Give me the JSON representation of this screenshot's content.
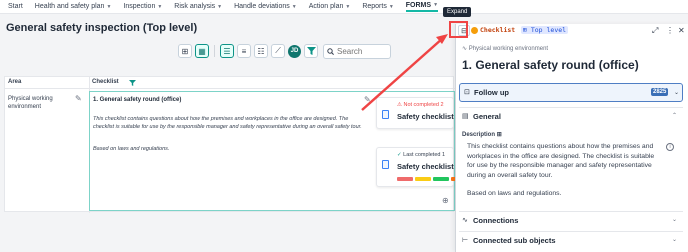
{
  "nav": {
    "items": [
      {
        "label": "Start",
        "dropdown": false
      },
      {
        "label": "Health and safety plan",
        "dropdown": true
      },
      {
        "label": "Inspection",
        "dropdown": true
      },
      {
        "label": "Risk analysis",
        "dropdown": true
      },
      {
        "label": "Handle deviations",
        "dropdown": true
      },
      {
        "label": "Action plan",
        "dropdown": true
      },
      {
        "label": "Reports",
        "dropdown": true
      },
      {
        "label": "FORMS",
        "dropdown": true
      }
    ],
    "active": "FORMS"
  },
  "page": {
    "title": "General safety inspection (Top level)"
  },
  "toolbar": {
    "avatar_initials": "JD",
    "search_placeholder": "Search"
  },
  "grid": {
    "columns": [
      "Area",
      "Checklist"
    ],
    "row": {
      "area": "Physical working environment",
      "checklist_title": "1. General safety round (office)",
      "checklist_desc": "This checklist contains questions about how the premises and workplaces in the office are designed. The checklist is suitable for use by the responsible manager and safety representative during an overall safety tour.",
      "checklist_based": "Based on laws and regulations."
    },
    "cards": [
      {
        "status": "Not completed",
        "status_suffix": "2",
        "title": "Safety checklist",
        "status_color": "#ef4444"
      },
      {
        "status": "Last completed",
        "status_suffix": "1",
        "title": "Safety checklist",
        "status_color": "#0d9488"
      }
    ],
    "bar_colors": [
      "#ef6b6b",
      "#facc15",
      "#22c55e",
      "#f97316"
    ]
  },
  "tooltip": {
    "label": "Expand"
  },
  "panel": {
    "tag_checklist": "Checklist",
    "tag_top": "Top level",
    "subtitle": "Physical working environment",
    "title": "1. General safety round (office)",
    "followup": {
      "label": "Follow up",
      "count": "2825"
    },
    "general": {
      "label": "General",
      "description_label": "Description",
      "description": "This checklist contains questions about how the premises and workplaces in the office are designed. The checklist is suitable for use by the responsible manager and safety representative during an overall safety tour.",
      "based": "Based on laws and regulations."
    },
    "connections": {
      "label": "Connections"
    },
    "sub_objects": {
      "label": "Connected sub objects"
    }
  },
  "colors": {
    "accent": "#14b8a6",
    "highlight": "#ef4444",
    "followup_border": "#4f7ec4"
  }
}
